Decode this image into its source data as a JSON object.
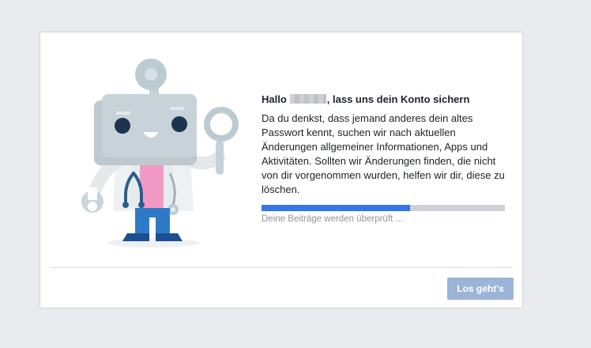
{
  "dialog": {
    "title_prefix": "Hallo",
    "title_suffix": ", lass uns dein Konto sichern",
    "body": "Da du denkst, dass jemand anderes dein altes Passwort kennt, suchen wir nach aktuellen Änderungen allgemeiner Informationen, Apps und Aktivitäten. Sollten wir Änderungen finden, die nicht von dir vorgenommen wurden, helfen wir dir, diese zu löschen.",
    "progress_label": "Deine Beiträge werden überprüft ...",
    "progress_fraction": 0.61,
    "button_label": "Los geht's"
  },
  "colors": {
    "page_bg": "#e9ebee",
    "progress_fill": "#3578e5",
    "progress_track": "#cdd0d4",
    "button_bg": "#9cb4d8"
  },
  "icons": {
    "illustration": "robot-doctor-with-magnifying-glass-icon"
  }
}
